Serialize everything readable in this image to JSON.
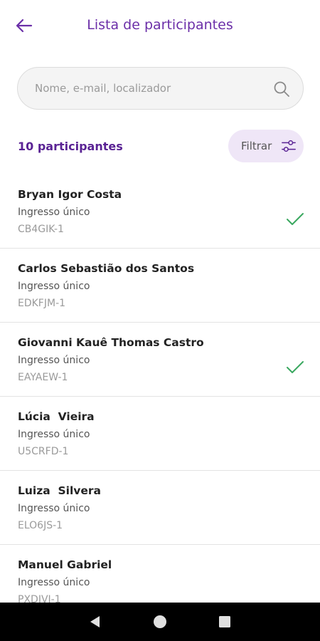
{
  "header": {
    "title": "Lista de participantes"
  },
  "search": {
    "placeholder": "Nome, e-mail, localizador"
  },
  "summary": {
    "count_label": "10 participantes",
    "filter_label": "Filtrar"
  },
  "participants": [
    {
      "name": "Bryan Igor Costa",
      "ticket": "Ingresso único",
      "code": "CB4GIK-1",
      "checked_in": true
    },
    {
      "name": "Carlos Sebastião dos Santos",
      "ticket": "Ingresso único",
      "code": "EDKFJM-1",
      "checked_in": false
    },
    {
      "name": "Giovanni Kauê Thomas Castro",
      "ticket": "Ingresso único",
      "code": "EAYAEW-1",
      "checked_in": true
    },
    {
      "name": "Lúcia  Vieira",
      "ticket": "Ingresso único",
      "code": "U5CRFD-1",
      "checked_in": false
    },
    {
      "name": "Luiza  Silvera",
      "ticket": "Ingresso único",
      "code": "ELO6JS-1",
      "checked_in": false
    },
    {
      "name": "Manuel Gabriel",
      "ticket": "Ingresso único",
      "code": "PXDIVI-1",
      "checked_in": false
    }
  ],
  "colors": {
    "accent": "#6b2fa8",
    "check": "#3aa860",
    "filter_bg": "#efe6f7"
  },
  "icons": {
    "back": "arrow-left-icon",
    "search": "search-icon",
    "filter": "filter-icon",
    "check": "check-icon"
  }
}
